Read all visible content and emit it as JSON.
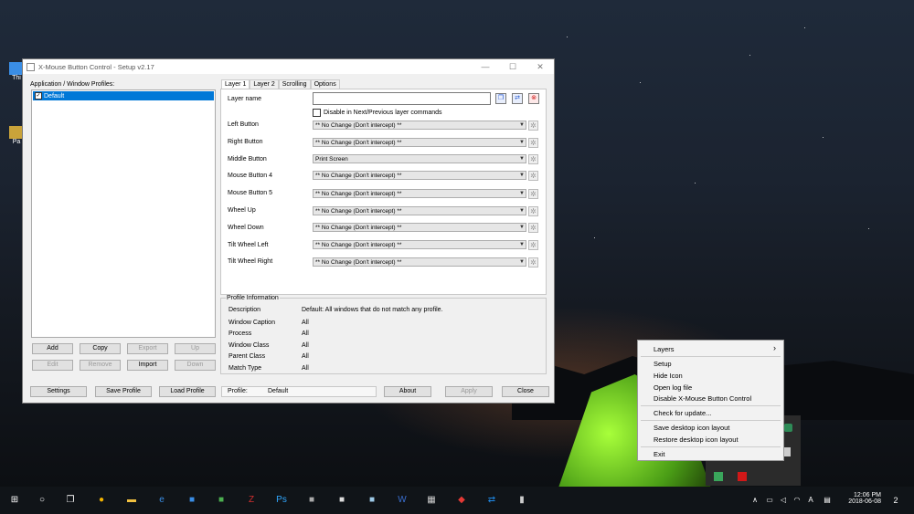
{
  "desktop": {
    "icons": [
      {
        "label": "Thi"
      },
      {
        "label": "Pa"
      }
    ]
  },
  "window": {
    "title": "X-Mouse Button Control - Setup v2.17",
    "controls": [
      "—",
      "☐",
      "✕"
    ],
    "profiles_label": "Application / Window Profiles:",
    "profiles": [
      {
        "name": "Default",
        "checked": "✓"
      }
    ],
    "profile_buttons": {
      "add": "Add",
      "copy": "Copy",
      "export": "Export",
      "up": "Up",
      "edit": "Edit",
      "remove": "Remove",
      "import": "Import",
      "down": "Down"
    },
    "tabs": [
      "Layer 1",
      "Layer 2",
      "Scrolling",
      "Options"
    ],
    "layer_name_label": "Layer name",
    "layer_name_value": "",
    "disable_layer_label": "Disable in Next/Previous layer commands",
    "mappings": [
      {
        "label": "Left Button",
        "value": "** No Change (Don't intercept) **"
      },
      {
        "label": "Right Button",
        "value": "** No Change (Don't intercept) **"
      },
      {
        "label": "Middle Button",
        "value": "Print Screen"
      },
      {
        "label": "Mouse Button 4",
        "value": "** No Change (Don't intercept) **"
      },
      {
        "label": "Mouse Button 5",
        "value": "** No Change (Don't intercept) **"
      },
      {
        "label": "Wheel Up",
        "value": "** No Change (Don't intercept) **"
      },
      {
        "label": "Wheel Down",
        "value": "** No Change (Don't intercept) **"
      },
      {
        "label": "Tilt Wheel Left",
        "value": "** No Change (Don't intercept) **"
      },
      {
        "label": "Tilt Wheel Right",
        "value": "** No Change (Don't intercept) **"
      }
    ],
    "profile_info": {
      "header": "Profile Information",
      "rows": [
        {
          "label": "Description",
          "value": "Default: All windows that do not match any profile."
        },
        {
          "label": "Window Caption",
          "value": "All"
        },
        {
          "label": "Process",
          "value": "All"
        },
        {
          "label": "Window Class",
          "value": "All"
        },
        {
          "label": "Parent Class",
          "value": "All"
        },
        {
          "label": "Match Type",
          "value": "All"
        }
      ]
    },
    "bottom": {
      "settings": "Settings",
      "save_profile": "Save Profile",
      "load_profile": "Load Profile",
      "profile_label": "Profile:",
      "profile_value": "Default",
      "about": "About",
      "apply": "Apply",
      "close": "Close"
    }
  },
  "context_menu": {
    "items": [
      "Layers",
      "Setup",
      "Hide Icon",
      "Open log file",
      "Disable X-Mouse Button Control",
      "Check for update...",
      "Save desktop icon layout",
      "Restore desktop icon layout",
      "Exit"
    ],
    "submenu_arrow": "›"
  },
  "taskbar": {
    "time": "12:06 PM",
    "date": "2018-06-08",
    "notifications": "2",
    "lang": "A"
  }
}
